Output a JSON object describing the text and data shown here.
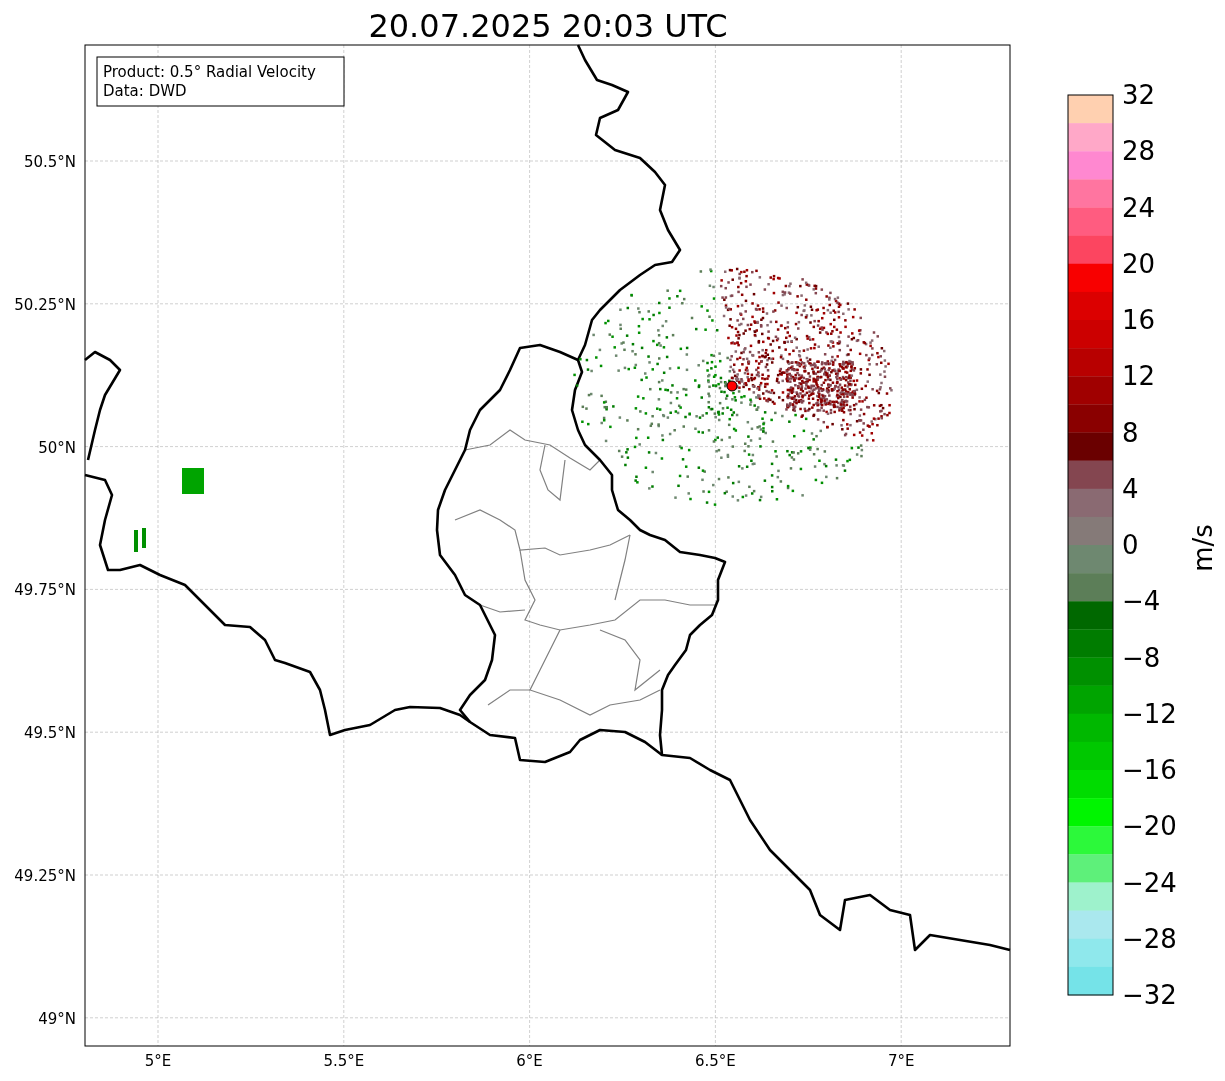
{
  "title": "20.07.2025 20:03 UTC",
  "info_box": [
    "Product: 0.5° Radial Velocity",
    "Data: DWD"
  ],
  "y_ticks": [
    "50.5°N",
    "50.25°N",
    "50°N",
    "49.75°N",
    "49.5°N",
    "49.25°N",
    "49°N"
  ],
  "x_ticks": [
    "5°E",
    "5.5°E",
    "6°E",
    "6.5°E",
    "7°E"
  ],
  "colorbar": {
    "label": "m/s",
    "ticks": [
      "32",
      "28",
      "24",
      "20",
      "16",
      "12",
      "8",
      "4",
      "0",
      "−4",
      "−8",
      "−12",
      "−16",
      "−20",
      "−24",
      "−28",
      "−32"
    ],
    "segments": [
      {
        "color": "#ffd0b0"
      },
      {
        "color": "#ffa8c8"
      },
      {
        "color": "#ff88d0"
      },
      {
        "color": "#ff75a0"
      },
      {
        "color": "#ff5c80"
      },
      {
        "color": "#fc4560"
      },
      {
        "color": "#f80000"
      },
      {
        "color": "#dc0000"
      },
      {
        "color": "#cc0000"
      },
      {
        "color": "#b80000"
      },
      {
        "color": "#a00000"
      },
      {
        "color": "#8a0000"
      },
      {
        "color": "#6a0000"
      },
      {
        "color": "#844650"
      },
      {
        "color": "#8a6a72"
      },
      {
        "color": "#857a78"
      },
      {
        "color": "#6e8870"
      },
      {
        "color": "#5c7e58"
      },
      {
        "color": "#006800"
      },
      {
        "color": "#007c00"
      },
      {
        "color": "#009000"
      },
      {
        "color": "#00a400"
      },
      {
        "color": "#00b800"
      },
      {
        "color": "#00c800"
      },
      {
        "color": "#00dc00"
      },
      {
        "color": "#00f500"
      },
      {
        "color": "#2cf93a"
      },
      {
        "color": "#5ef07a"
      },
      {
        "color": "#9ef2cc"
      },
      {
        "color": "#aae8ee"
      },
      {
        "color": "#8fe8ec"
      },
      {
        "color": "#75e3e8"
      }
    ]
  }
}
